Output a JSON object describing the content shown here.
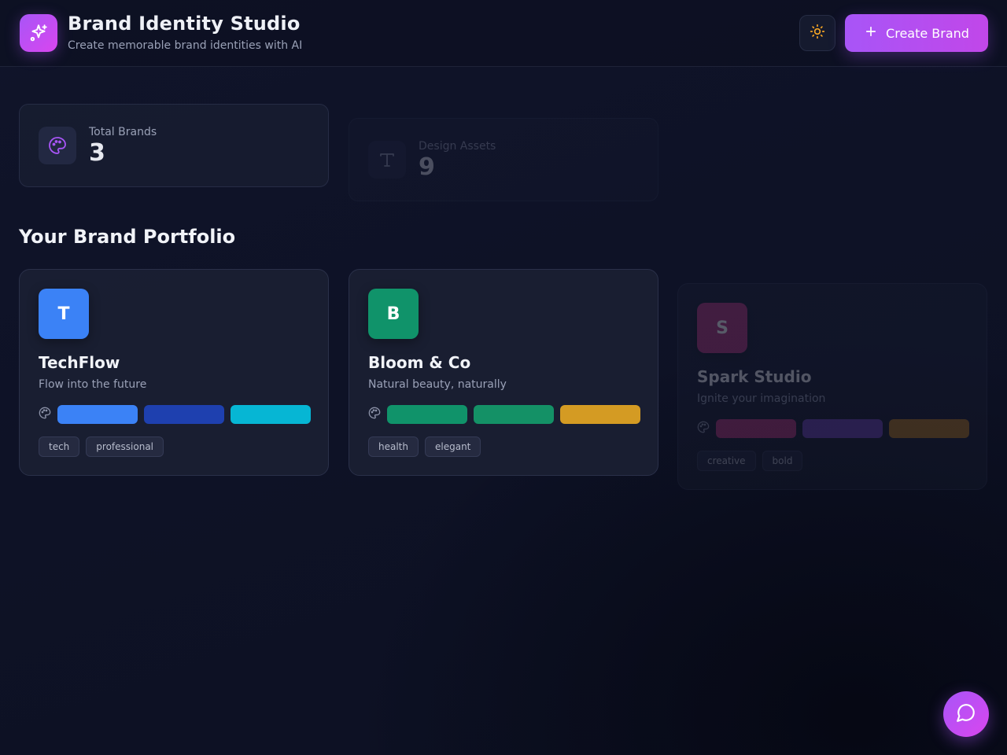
{
  "header": {
    "title": "Brand Identity Studio",
    "subtitle": "Create memorable brand identities with AI",
    "create_label": "Create Brand",
    "logo_icon": "sparkles-icon",
    "theme_icon": "sun-icon"
  },
  "stats": [
    {
      "label": "Total Brands",
      "value": "3",
      "icon": "palette-icon"
    },
    {
      "label": "Design Assets",
      "value": "9",
      "icon": "type-icon"
    }
  ],
  "portfolio": {
    "title": "Your Brand Portfolio",
    "brands": [
      {
        "initial": "T",
        "name": "TechFlow",
        "tagline": "Flow into the future",
        "avatar_color": "#3b82f6",
        "colors": [
          "#3b82f6",
          "#1e40af",
          "#06b6d4"
        ],
        "tags": [
          "tech",
          "professional"
        ]
      },
      {
        "initial": "B",
        "name": "Bloom & Co",
        "tagline": "Natural beauty, naturally",
        "avatar_color": "#10936a",
        "colors": [
          "#10936a",
          "#149166",
          "#d49b23"
        ],
        "tags": [
          "health",
          "elegant"
        ]
      },
      {
        "initial": "S",
        "name": "Spark Studio",
        "tagline": "Ignite your imagination",
        "avatar_color": "#b7387f",
        "colors": [
          "#b7387f",
          "#6e46b8",
          "#b57a22"
        ],
        "tags": [
          "creative",
          "bold"
        ]
      }
    ]
  },
  "chat": {
    "icon": "message-circle-icon"
  },
  "accent": "#a855f7"
}
